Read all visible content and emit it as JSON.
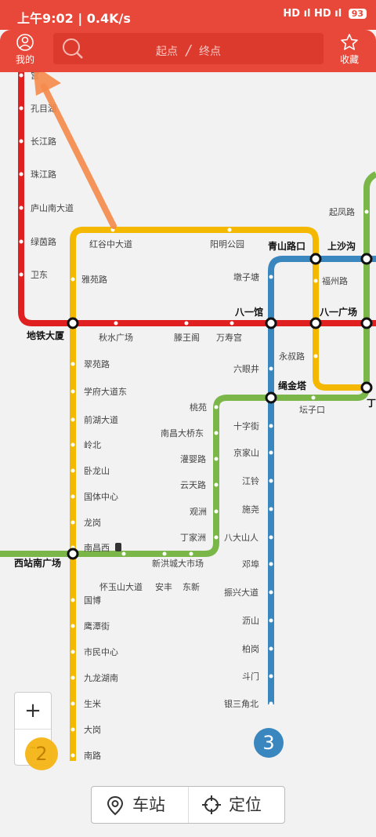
{
  "status_bar": {
    "time": "上午9:02",
    "speed": "0.4K/s",
    "network": "HD ıl HD ıl",
    "battery": "93"
  },
  "header": {
    "my_label": "我的",
    "origin_placeholder": "起点",
    "separator": "/",
    "dest_placeholder": "终点",
    "fav_label": "收藏"
  },
  "stations": {
    "line1_top": "宫",
    "kongmu": "孔目湖",
    "changjiang": "长江路",
    "zhujiang": "珠江路",
    "lushan": "庐山南大道",
    "lvyin": "绿茵路",
    "weidong": "卫东",
    "hongu": "红谷中大道",
    "yangming": "阳明公园",
    "qingshan": "青山路口",
    "shangsha": "上沙沟",
    "qifeng": "起凤路",
    "dunzitang": "墩子塘",
    "fuzhou": "福州路",
    "yayuan": "雅苑路",
    "ditiedasha": "地铁大厦",
    "qiushui": "秋水广场",
    "tengwang": "滕王阁",
    "wanshougong": "万寿宫",
    "bayiguan": "八一馆",
    "bayiguangchang": "八一广场",
    "liuyanjing": "六眼井",
    "yongshu": "永叔路",
    "shengjinta": "绳金塔",
    "tanzikou": "坛子口",
    "ding": "丁",
    "cuiyuan": "翠苑路",
    "xuefu": "学府大道东",
    "qianhu": "前湖大道",
    "lingbei": "岭北",
    "wolong": "卧龙山",
    "guoti": "国体中心",
    "longgang": "龙岗",
    "nanchangxi": "南昌西",
    "xizhan": "西站南广场",
    "guobo": "国博",
    "yingtan": "鹰潭街",
    "shimin": "市民中心",
    "jiulong": "九龙湖南",
    "shengmi": "生米",
    "dagang": "大岗",
    "nanlu": "南路",
    "taoyuan": "桃苑",
    "nanchangdaqiao": "南昌大桥东",
    "guanying": "灌婴路",
    "yuntian": "云天路",
    "guanzhou": "观洲",
    "dingjiazhou": "丁家洲",
    "xinhong": "新洪城大市场",
    "huaiyushan": "怀玉山大道",
    "anfeng": "安丰",
    "dongxin": "东新",
    "shizijie": "十字街",
    "jingjiashan": "京家山",
    "jiangling": "江铃",
    "shiyao": "施尧",
    "badashanren": "八大山人",
    "zhanghu": "邓埠",
    "zhenxing": "振兴大道",
    "lishan": "沥山",
    "baigang": "柏岗",
    "doumen": "斗门",
    "yinsanjiao": "银三角北"
  },
  "lines": {
    "line1_color": "#e02020",
    "line2_color": "#f5b800",
    "line3_color": "#3a87c0",
    "line4_color": "#7ab648"
  },
  "controls": {
    "zoom_in": "+",
    "zoom_out": "-",
    "tap_marker": "2",
    "line3_badge": "3",
    "station_button": "车站",
    "locate_button": "定位"
  },
  "icons": {
    "my": "user-circle-icon",
    "search": "search-icon",
    "fav": "star-icon",
    "station": "location-pin-icon",
    "locate": "crosshair-icon"
  }
}
